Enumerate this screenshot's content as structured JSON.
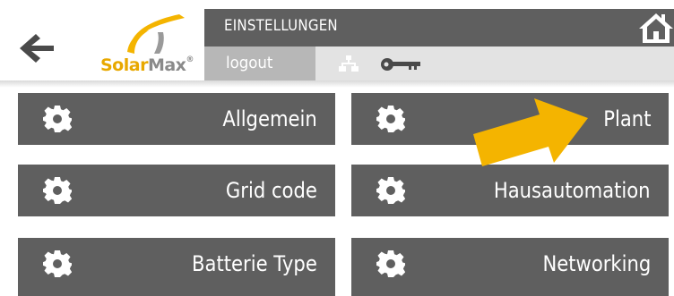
{
  "header": {
    "title": "EINSTELLUNGEN",
    "logout_label": "logout",
    "brand": {
      "solar": "Solar",
      "max": "Max",
      "trademark": "®"
    }
  },
  "icons": {
    "back": "arrow-left-icon",
    "home": "home-icon",
    "network": "network-icon",
    "key": "key-icon",
    "tile": "gear-icon"
  },
  "menu": {
    "left": [
      {
        "label": "Allgemein"
      },
      {
        "label": "Grid code"
      },
      {
        "label": "Batterie Type"
      }
    ],
    "right": [
      {
        "label": "Plant"
      },
      {
        "label": "Hausautomation"
      },
      {
        "label": "Networking"
      }
    ]
  },
  "colors": {
    "tile": "#5f5f5f",
    "subbar": "#e3e3e3",
    "logout": "#b7b7b7",
    "accent": "#f4b400"
  }
}
